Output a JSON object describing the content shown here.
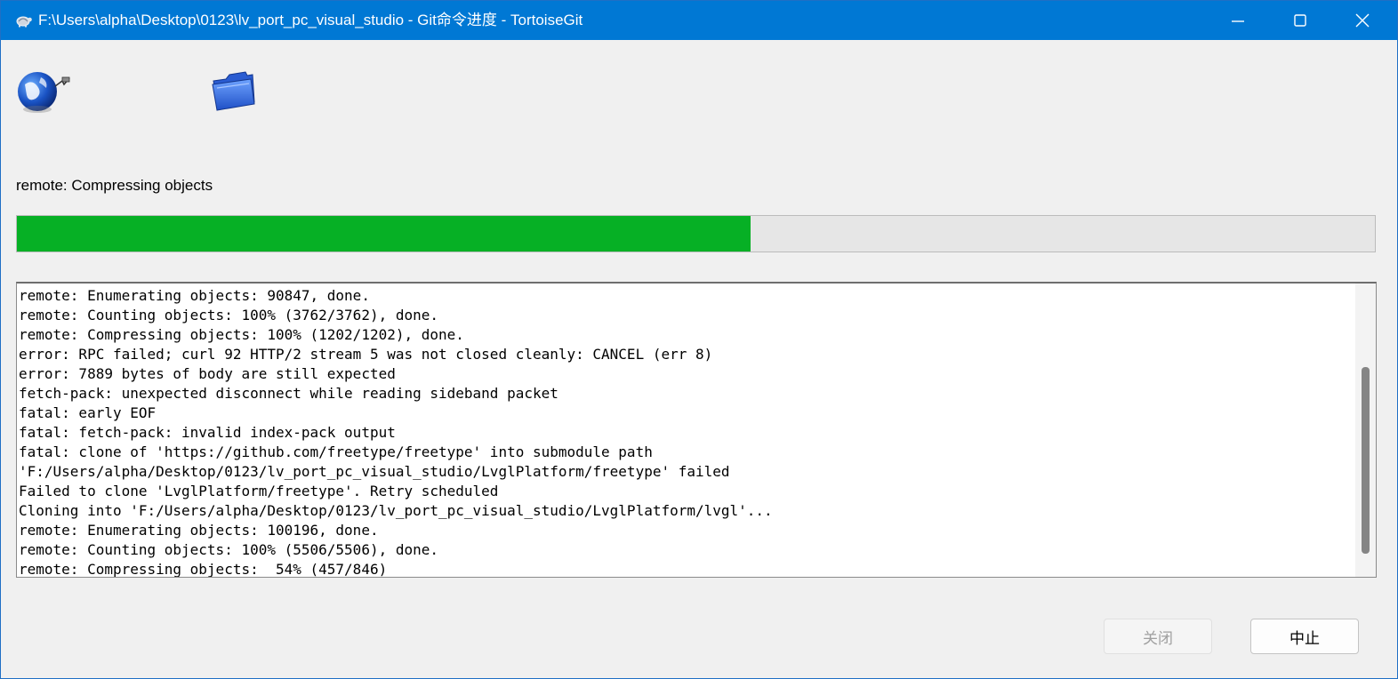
{
  "window": {
    "title": "F:\\Users\\alpha\\Desktop\\0123\\lv_port_pc_visual_studio - Git命令进度 - TortoiseGit",
    "accent_color": "#0078d4",
    "controls": {
      "minimize_icon": "minimize-icon",
      "maximize_icon": "maximize-icon",
      "close_icon": "close-icon"
    }
  },
  "icons": {
    "left": "globe-icon",
    "right": "folder-icon"
  },
  "status": {
    "text": "remote: Compressing objects"
  },
  "progress": {
    "percent": 54,
    "fill_color": "#06b025"
  },
  "log": {
    "lines": [
      "remote: Enumerating objects: 90847, done.",
      "remote: Counting objects: 100% (3762/3762), done.",
      "remote: Compressing objects: 100% (1202/1202), done.",
      "error: RPC failed; curl 92 HTTP/2 stream 5 was not closed cleanly: CANCEL (err 8)",
      "error: 7889 bytes of body are still expected",
      "fetch-pack: unexpected disconnect while reading sideband packet",
      "fatal: early EOF",
      "fatal: fetch-pack: invalid index-pack output",
      "fatal: clone of 'https://github.com/freetype/freetype' into submodule path",
      "'F:/Users/alpha/Desktop/0123/lv_port_pc_visual_studio/LvglPlatform/freetype' failed",
      "Failed to clone 'LvglPlatform/freetype'. Retry scheduled",
      "Cloning into 'F:/Users/alpha/Desktop/0123/lv_port_pc_visual_studio/LvglPlatform/lvgl'...",
      "remote: Enumerating objects: 100196, done.",
      "remote: Counting objects: 100% (5506/5506), done.",
      "remote: Compressing objects:  54% (457/846)"
    ]
  },
  "buttons": {
    "close_label": "关闭",
    "abort_label": "中止"
  }
}
